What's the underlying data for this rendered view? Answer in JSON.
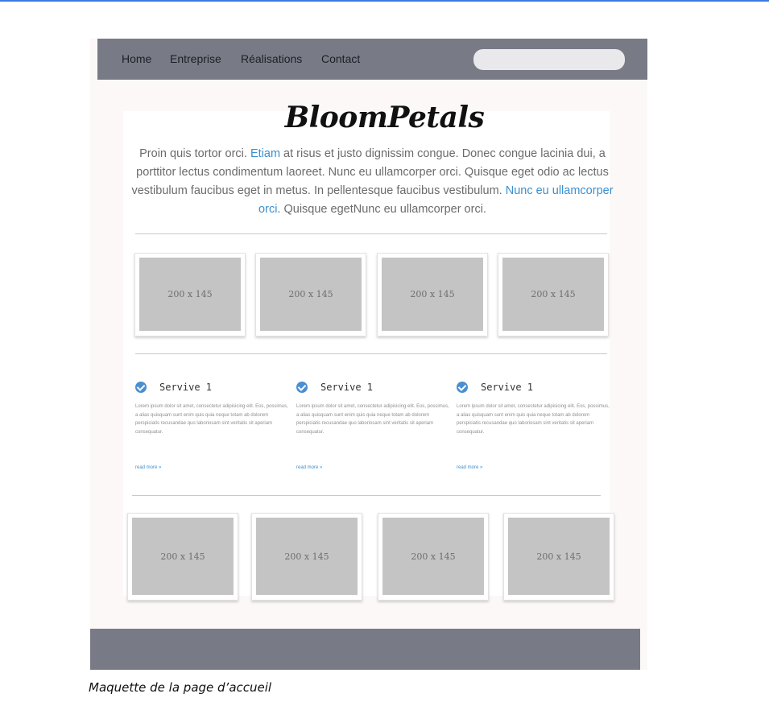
{
  "nav": {
    "items": [
      "Home",
      "Entreprise",
      "Réalisations",
      "Contact"
    ],
    "search_placeholder": ""
  },
  "brand": {
    "logo": "BloomPetals"
  },
  "intro": {
    "p1": "Proin quis tortor orci. ",
    "l1": "Etiam",
    "p2": " at risus et justo dignissim congue. Donec congue lacinia dui, a porttitor lectus condimentum laoreet. Nunc eu ullamcorper orci. Quisque eget odio ac lectus vestibulum faucibus eget in metus. In pellentesque faucibus vestibulum. ",
    "l2": "Nunc eu ullamcorper orci",
    "p3": ". Quisque egetNunc eu ullamcorper orci."
  },
  "gallery_top": [
    "200 x 145",
    "200 x 145",
    "200 x 145",
    "200 x 145"
  ],
  "services": [
    {
      "title": "Servive 1",
      "text": "Lorem ipsum dolor sit amet, consectetur adipisicing elit. Eos, possimus, a alias quisquam sunt enim quis quia neque totam ab dolorem perspiciatis recusandae quo laboriosam sint veritatis sit aperiam consequatur.",
      "link": "read more »"
    },
    {
      "title": "Servive 1",
      "text": "Lorem ipsum dolor sit amet, consectetur adipisicing elit. Eos, possimus, a alias quisquam sunt enim quis quia neque totam ab dolorem perspiciatis recusandae quo laboriosam sint veritatis sit aperiam consequatur.",
      "link": "read more »"
    },
    {
      "title": "Servive 1",
      "text": "Lorem ipsum dolor sit amet, consectetur adipisicing elit. Eos, possimus, a alias quisquam sunt enim quis quia neque totam ab dolorem perspiciatis recusandae quo laboriosam sint veritatis sit aperiam consequatur.",
      "link": "read more »"
    }
  ],
  "gallery_bottom": [
    "200 x 145",
    "200 x 145",
    "200 x 145",
    "200 x 145"
  ],
  "caption": "Maquette de la page d’accueil",
  "colors": {
    "nav_bg": "#787b86",
    "link": "#3b8fcf",
    "placeholder": "#c4c4c4",
    "top_line": "#3a7be0"
  }
}
